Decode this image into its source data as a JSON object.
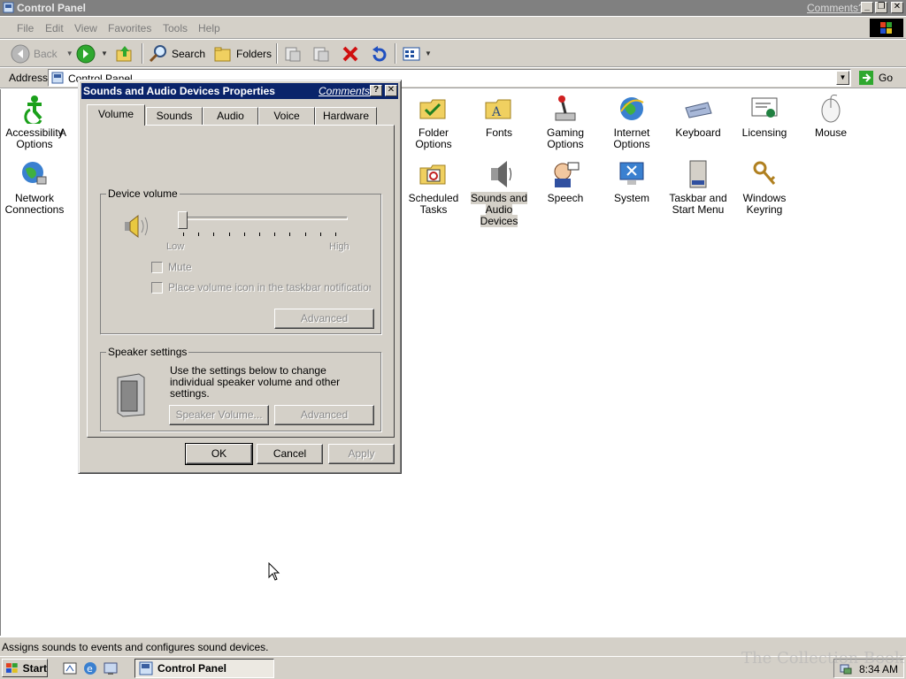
{
  "window": {
    "title": "Control Panel",
    "comments_link": "Comments?"
  },
  "menu": [
    "File",
    "Edit",
    "View",
    "Favorites",
    "Tools",
    "Help"
  ],
  "toolbar": {
    "back_label": "Back",
    "search_label": "Search",
    "folders_label": "Folders"
  },
  "address": {
    "label": "Address",
    "value": "Control Panel",
    "go_label": "Go"
  },
  "items": [
    "Accessibility Options",
    "Folder Options",
    "Fonts",
    "Gaming Options",
    "Internet Options",
    "Keyboard",
    "Licensing",
    "Mouse",
    "Network Connections",
    "Scheduled Tasks",
    "Sounds and Audio Devices",
    "Speech",
    "System",
    "Taskbar and Start Menu",
    "Windows Keyring"
  ],
  "items_partial": "A",
  "status": {
    "text": "Assigns sounds to events and configures sound devices."
  },
  "taskbar": {
    "start_label": "Start",
    "task_label": "Control Panel",
    "clock": "8:34 AM",
    "watermark": "The Collection Book"
  },
  "dialog": {
    "title": "Sounds and Audio Devices Properties",
    "comments_link": "Comments?",
    "tabs": [
      "Volume",
      "Sounds",
      "Audio",
      "Voice",
      "Hardware"
    ],
    "device_volume": {
      "group_title": "Device volume",
      "low_label": "Low",
      "high_label": "High",
      "level": 0,
      "mute_label": "Mute",
      "tray_icon_label": "Place volume icon in the taskbar notification area",
      "advanced_label": "Advanced"
    },
    "speaker_settings": {
      "group_title": "Speaker settings",
      "description": "Use the settings below to change individual speaker volume and other settings.",
      "speaker_volume_label": "Speaker Volume...",
      "advanced_label": "Advanced"
    },
    "buttons": {
      "ok": "OK",
      "cancel": "Cancel",
      "apply": "Apply"
    }
  },
  "colors": {
    "face": "#d4d0c8",
    "dialog_title": "#0a246a",
    "window_title_inactive": "#808080"
  }
}
